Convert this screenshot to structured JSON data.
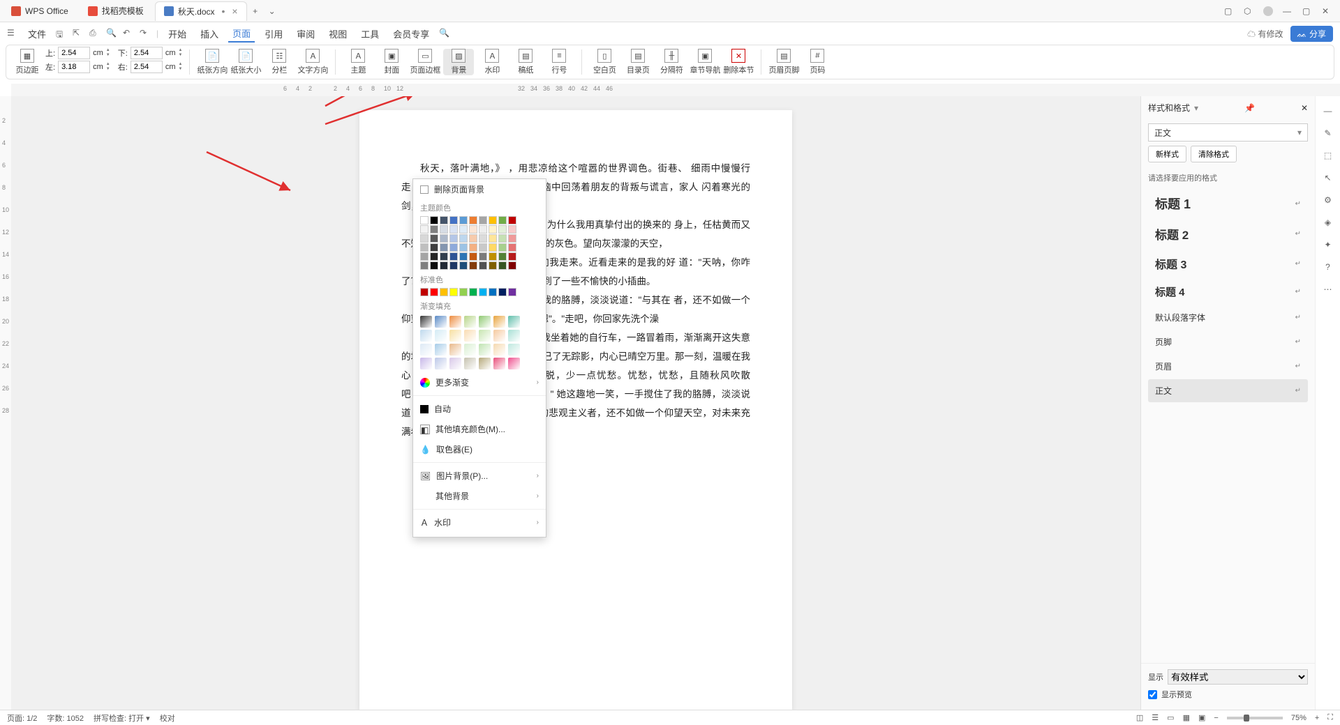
{
  "titlebar": {
    "tabs": [
      {
        "icon": "wps",
        "label": "WPS Office"
      },
      {
        "icon": "tpl",
        "label": "找稻壳模板"
      },
      {
        "icon": "doc",
        "label": "秋天.docx"
      }
    ],
    "add": "+"
  },
  "menubar": {
    "file": "文件",
    "items": [
      "开始",
      "插入",
      "页面",
      "引用",
      "审阅",
      "视图",
      "工具",
      "会员专享"
    ],
    "active": 2,
    "has_changes": "有修改",
    "share": "分享"
  },
  "ribbon": {
    "margin_btn": "页边距",
    "top": "上:",
    "top_v": "2.54",
    "unit": "cm",
    "bottom": "下:",
    "bottom_v": "2.54",
    "left": "左:",
    "left_v": "3.18",
    "right": "右:",
    "right_v": "2.54",
    "orient": "纸张方向",
    "size": "纸张大小",
    "columns": "分栏",
    "textdir": "文字方向",
    "theme": "主题",
    "cover": "封面",
    "border": "页面边框",
    "bg": "背景",
    "water": "水印",
    "paper": "稿纸",
    "lineno": "行号",
    "blank": "空白页",
    "toc": "目录页",
    "pagebreak": "分隔符",
    "nav": "章节导航",
    "delsec": "删除本节",
    "hf": "页眉页脚",
    "pageno": "页码"
  },
  "ruler_h": [
    "6",
    "4",
    "2",
    "",
    "2",
    "4",
    "6",
    "8",
    "10",
    "12"
  ],
  "ruler_h2": [
    "32",
    "34",
    "36",
    "38",
    "40",
    "42",
    "44",
    "46"
  ],
  "ruler_v": [
    "2",
    "4",
    "6",
    "8",
    "10",
    "12",
    "14",
    "16",
    "18",
    "20",
    "22",
    "24",
    "26",
    "28"
  ],
  "doc": {
    "p1": "秋天，落叶满地，》                                                         ，用悲凉给这个喧嚣的世界调色。街巷、                                                         细雨中慢慢行走，昏黄的街灯无力地洒下                                                   。我脑中回荡着朋友的背叛与谎言，家人                                                   闪着寒光的剑，从背后深深地刺进我的",
    "p2": "滴滴答答，是雨在倾                                                         干眼眸，为什么我用真挚付出的换来的                                                     身上，任枯黄而又不知名的叶子从我身身                                               色——冰冷的灰色。望向灰濛濛的天空，",
    "p3": "走着走着，远处一                                                           伞，匆匆向我走来。近看走来的是我的好                                                   道：\"天呐，你咋了？谁欺负你了？\"我                                                   道：\"只是碰到了一些不愉快的小插曲。",
    "p4": "\"唉，看来那个插曲                                                 手搅住了我的胳膊，淡淡说道：\"与其在                                                     者，还不如做一个仰望天空，对未来充满                                               子答道：\"嗯\"。\"走吧，你回家先洗个澡",
    "p5": "\"好\"，我看着她说道。就这样我坐着她的自行车，一路冒着雨，渐渐离开这失意的场所。这时候，我内心里的忧愁已了无踪影，内心已晴空万里。那一刻，温暖在我心中荡漾。青春的刻，多一点洒脱，少一点忧愁。忧愁，忧愁，且随秋风吹散吧！\"唉，看来那个插曲还挺大的。\" 她这趣地一笑，一手搅住了我的胳膊，淡淡说道：\"与其在这里做一个怨天尤人的悲观主义者，还不如做一个仰望天空，对未来充满希望的乐观主义者。\""
  },
  "dropdown": {
    "remove_bg": "删除页面背景",
    "theme_colors": "主题颜色",
    "standard": "标准色",
    "gradient": "渐变填充",
    "more_gradient": "更多渐变",
    "auto": "自动",
    "other_fill": "其他填充颜色(M)...",
    "picker": "取色器(E)",
    "pic_bg": "图片背景(P)...",
    "other_bg": "其他背景",
    "watermark": "水印",
    "theme_palette": [
      [
        "#ffffff",
        "#000000",
        "#44546a",
        "#4472c4",
        "#5b9bd5",
        "#ed7d31",
        "#a5a5a5",
        "#ffc000",
        "#70ad47",
        "#c00000"
      ],
      [
        "#f2f2f2",
        "#7f7f7f",
        "#d6dce4",
        "#d9e2f3",
        "#deebf6",
        "#fbe5d5",
        "#ededed",
        "#fff2cc",
        "#e2efd9",
        "#f7caca"
      ],
      [
        "#d8d8d8",
        "#595959",
        "#adb9ca",
        "#b4c6e7",
        "#bdd7ee",
        "#f7cbac",
        "#dbdbdb",
        "#fee599",
        "#c5e0b3",
        "#ef9a9a"
      ],
      [
        "#bfbfbf",
        "#3f3f3f",
        "#8496b0",
        "#8eaadb",
        "#9cc3e5",
        "#f4b183",
        "#c9c9c9",
        "#ffd965",
        "#a8d08d",
        "#e57373"
      ],
      [
        "#a5a5a5",
        "#262626",
        "#323f4f",
        "#2f5496",
        "#2e75b5",
        "#c55a11",
        "#7b7b7b",
        "#bf9000",
        "#538135",
        "#b71c1c"
      ],
      [
        "#7f7f7f",
        "#0c0c0c",
        "#222a35",
        "#1f3864",
        "#1e4e79",
        "#833c0b",
        "#525252",
        "#7f6000",
        "#375623",
        "#7f0000"
      ]
    ],
    "std_palette": [
      "#c00000",
      "#ff0000",
      "#ffc000",
      "#ffff00",
      "#92d050",
      "#00b050",
      "#00b0f0",
      "#0070c0",
      "#002060",
      "#7030a0"
    ],
    "grad_palette1": [
      "#333333",
      "#5a8ac6",
      "#ed8b3e",
      "#b7d589",
      "#8fc972",
      "#e8a33d",
      "#5fbeaa"
    ],
    "grad_palette2": [
      "#bfd9ed",
      "#d4ebf5",
      "#f7dfa0",
      "#f9dcb2",
      "#c7e5b0",
      "#f5c99e",
      "#a8e0d5"
    ],
    "grad_palette3": [
      "#dde9f5",
      "#a6cce8",
      "#e8b889",
      "#d9efd2",
      "#bfe3b1",
      "#f5d9b0",
      "#bfe8df"
    ],
    "grad_palette4": [
      "#c8b8e8",
      "#bdc8e8",
      "#d8c8e8",
      "#c6c2af",
      "#b5a87a",
      "#e84f7a",
      "#ee4f8e"
    ]
  },
  "panel": {
    "title": "样式和格式",
    "current": "正文",
    "new_style": "新样式",
    "clear": "清除格式",
    "hint": "请选择要应用的格式",
    "styles": [
      {
        "name": "标题 1",
        "fs": "18px",
        "fw": "bold"
      },
      {
        "name": "标题 2",
        "fs": "17px",
        "fw": "bold"
      },
      {
        "name": "标题 3",
        "fs": "16px",
        "fw": "bold"
      },
      {
        "name": "标题 4",
        "fs": "15px",
        "fw": "bold"
      },
      {
        "name": "默认段落字体",
        "fs": "12px",
        "fw": "normal"
      },
      {
        "name": "页脚",
        "fs": "12px",
        "fw": "normal"
      },
      {
        "name": "页眉",
        "fs": "12px",
        "fw": "normal"
      },
      {
        "name": "正文",
        "fs": "12px",
        "fw": "normal",
        "sel": true
      }
    ],
    "show": "显示",
    "show_val": "有效样式",
    "preview": "显示预览"
  },
  "status": {
    "page": "页面: 1/2",
    "words": "字数: 1052",
    "spell": "拼写检查: 打开",
    "proof": "校对",
    "zoom": "75%"
  }
}
